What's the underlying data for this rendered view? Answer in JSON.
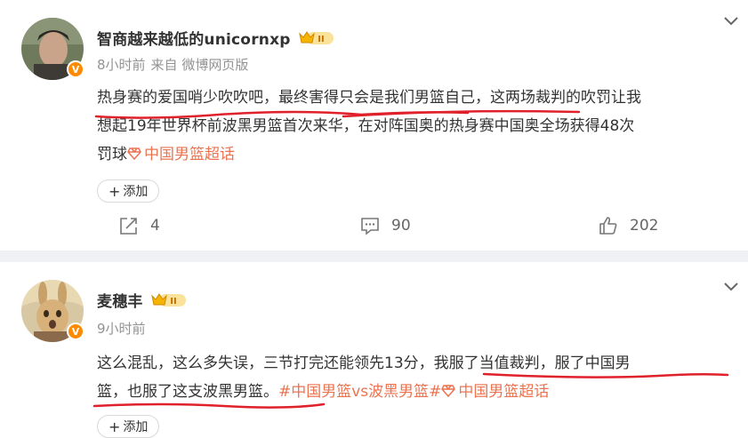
{
  "posts": [
    {
      "username": "智商越来越低的unicornxp",
      "medal_level": "II",
      "vip_badge": "V",
      "meta": {
        "time": "8小时前",
        "source": "来自 微博网页版"
      },
      "content": {
        "line1": "热身赛的爱国哨少吹吹吧，最终害得只会是我们男篮自己，这两场裁判的吹罚让我",
        "line2": "想起19年世界杯前波黑男篮首次来华，在对阵国奥的热身赛中国奥全场获得48次",
        "line3_text": "罚球",
        "line3_tag": "中国男篮超话"
      },
      "add_label": "添加",
      "add_plus": "+",
      "actions": {
        "share": "4",
        "comment": "90",
        "like": "202"
      }
    },
    {
      "username": "麦穗丰",
      "medal_level": "II",
      "vip_badge": "V",
      "meta": {
        "time": "9小时前"
      },
      "content": {
        "line1": "这么混乱，这么多失误，三节打完还能领先13分，我服了当值裁判，服了中国男",
        "line2_text": "篮，也服了这支波黑男篮。",
        "line2_tag1": "#中国男篮vs波黑男篮#",
        "line2_tag2": "中国男篮超话"
      },
      "add_label": "添加",
      "add_plus": "+"
    }
  ],
  "colors": {
    "accent": "#eb7350",
    "underline": "#e0202a",
    "medal": "#f5b400",
    "vip": "#ff8a00"
  }
}
